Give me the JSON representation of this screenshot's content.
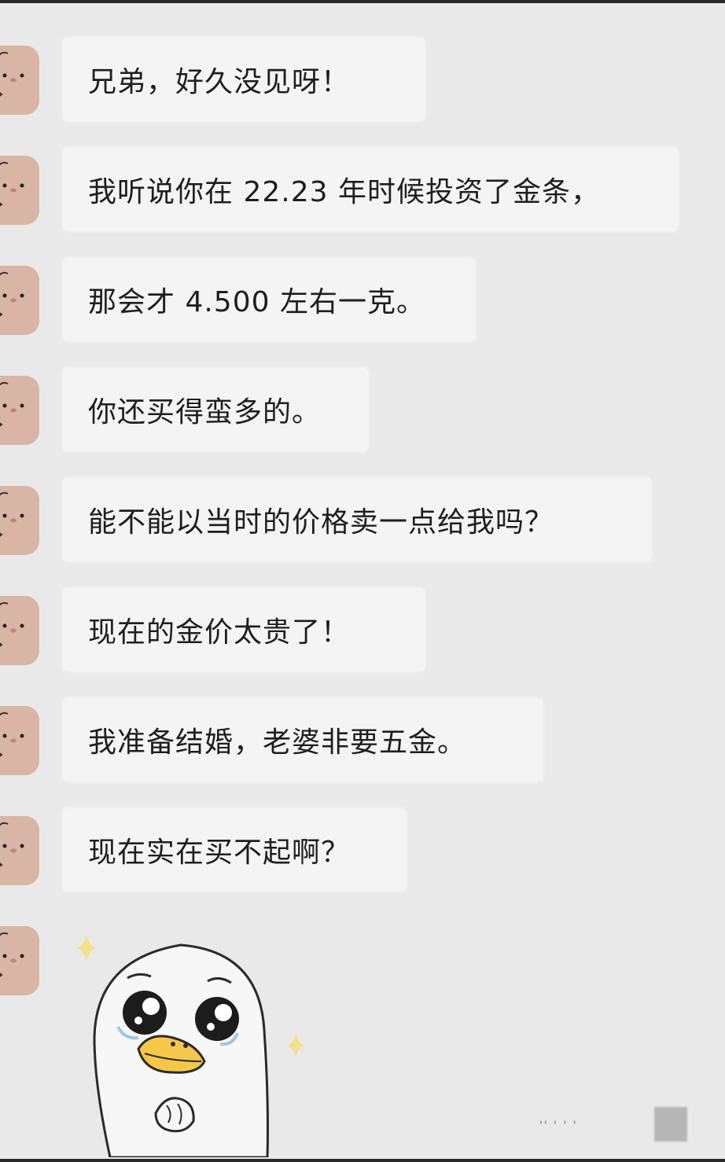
{
  "chat": {
    "messages": [
      {
        "text": "兄弟，好久没见呀！"
      },
      {
        "text": "我听说你在 22.23 年时候投资了金条，"
      },
      {
        "text": "那会才 4.500 左右一克。"
      },
      {
        "text": "你还买得蛮多的。"
      },
      {
        "text": "能不能以当时的价格卖一点给我吗？"
      },
      {
        "text": "现在的金价太贵了！"
      },
      {
        "text": "我准备结婚，老婆非要五金。"
      },
      {
        "text": "现在实在买不起啊？"
      }
    ],
    "avatar_icon": "pig-avatar-icon",
    "sticker_icon": "crying-duck-sticker-icon"
  },
  "colors": {
    "background": "#e9e9ea",
    "bubble": "#f4f4f4",
    "avatar": "#d8b5a4",
    "duck_beak": "#f6c84a",
    "sparkle": "#f4e08a"
  }
}
